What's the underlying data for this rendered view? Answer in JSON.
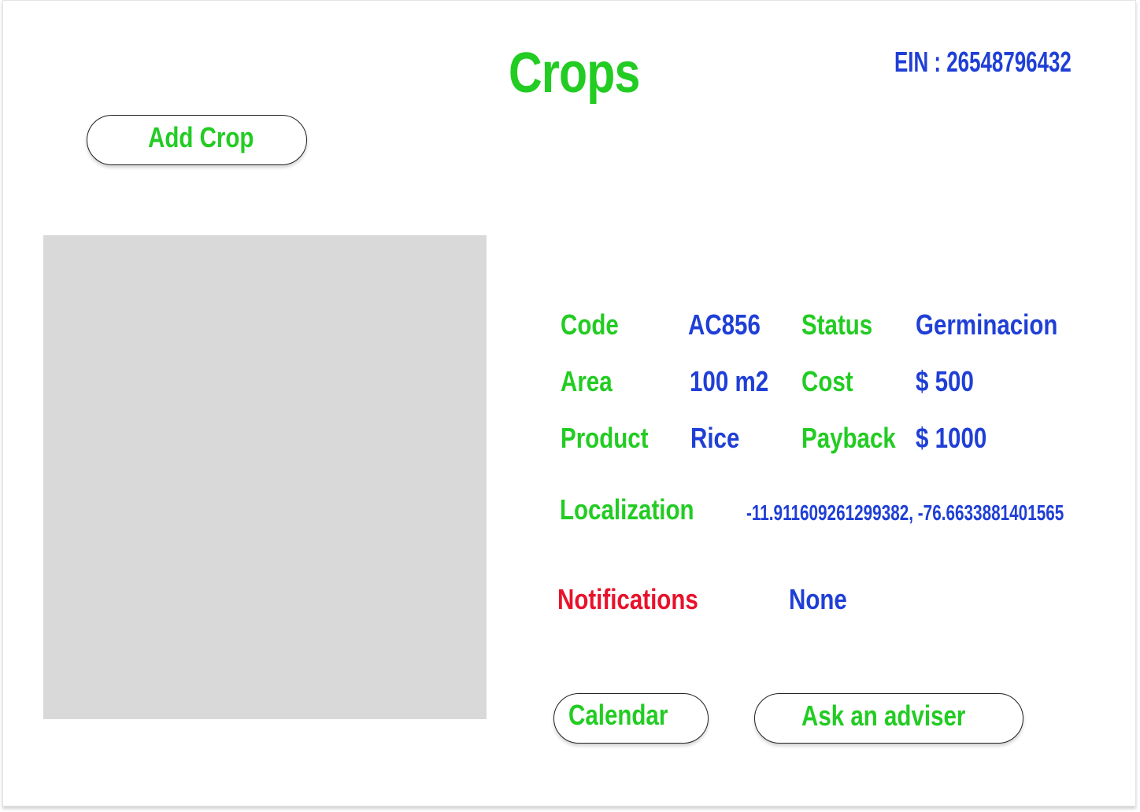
{
  "page": {
    "title": "Crops",
    "ein_label": "EIN : 26548796432"
  },
  "actions": {
    "add_crop": "Add Crop",
    "calendar": "Calendar",
    "ask_adviser": "Ask an adviser"
  },
  "details": {
    "code_label": "Code",
    "code_value": "AC856",
    "status_label": "Status",
    "status_value": "Germinacion",
    "area_label": "Area",
    "area_value": "100 m2",
    "cost_label": "Cost",
    "cost_value": "$ 500",
    "product_label": "Product",
    "product_value": "Rice",
    "payback_label": "Payback",
    "payback_value": "$ 1000",
    "localization_label": "Localization",
    "localization_value": "-11.911609261299382, -76.6633881401565",
    "notifications_label": "Notifications",
    "notifications_value": "None"
  },
  "colors": {
    "label_green": "#22cc22",
    "value_blue": "#1f3fd6",
    "alert_red": "#e8122b",
    "placeholder_gray": "#d9d9d9"
  }
}
